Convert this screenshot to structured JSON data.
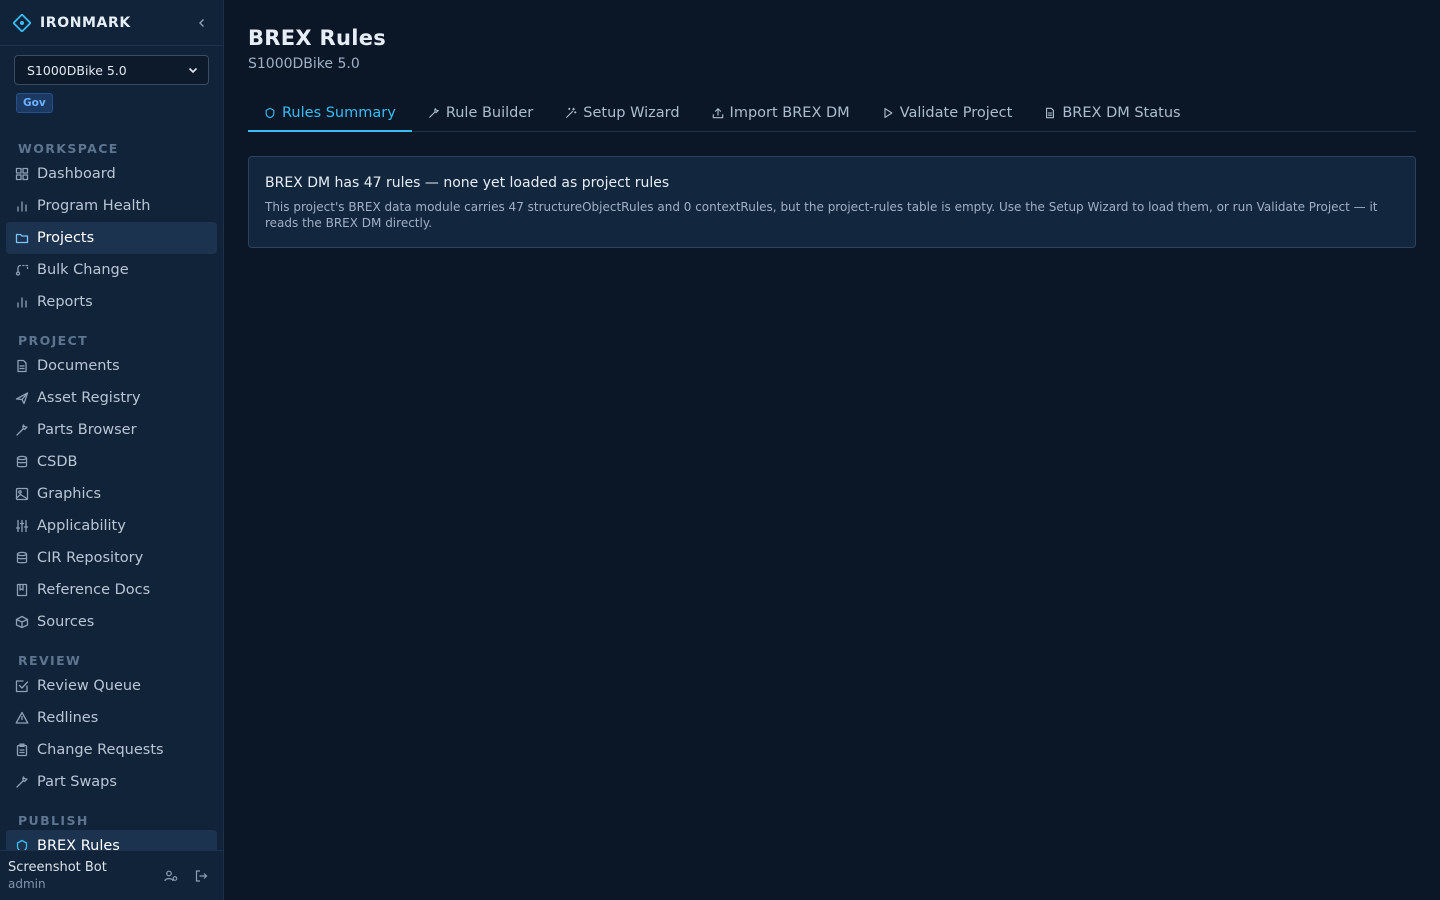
{
  "brand": {
    "name": "IRONMARK"
  },
  "project_select": {
    "value": "S1000DBike 5.0"
  },
  "badge": "Gov",
  "sections": {
    "workspace": "WORKSPACE",
    "project": "PROJECT",
    "review": "REVIEW",
    "publish": "PUBLISH"
  },
  "nav": {
    "workspace": [
      {
        "label": "Dashboard",
        "icon": "grid-icon"
      },
      {
        "label": "Program Health",
        "icon": "bar-chart-icon"
      },
      {
        "label": "Projects",
        "icon": "folder-icon",
        "active": true
      },
      {
        "label": "Bulk Change",
        "icon": "bulk-icon"
      },
      {
        "label": "Reports",
        "icon": "bar-chart-icon"
      }
    ],
    "project": [
      {
        "label": "Documents",
        "icon": "document-icon"
      },
      {
        "label": "Asset Registry",
        "icon": "plane-icon"
      },
      {
        "label": "Parts Browser",
        "icon": "wrench-icon"
      },
      {
        "label": "CSDB",
        "icon": "database-icon"
      },
      {
        "label": "Graphics",
        "icon": "image-icon"
      },
      {
        "label": "Applicability",
        "icon": "sliders-icon"
      },
      {
        "label": "CIR Repository",
        "icon": "database-icon"
      },
      {
        "label": "Reference Docs",
        "icon": "book-icon"
      },
      {
        "label": "Sources",
        "icon": "package-icon"
      }
    ],
    "review": [
      {
        "label": "Review Queue",
        "icon": "check-square-icon"
      },
      {
        "label": "Redlines",
        "icon": "warning-icon"
      },
      {
        "label": "Change Requests",
        "icon": "clipboard-icon"
      },
      {
        "label": "Part Swaps",
        "icon": "wrench-icon"
      }
    ],
    "publish": [
      {
        "label": "BREX Rules",
        "icon": "shield-icon",
        "active": true
      }
    ]
  },
  "user": {
    "name": "Screenshot Bot",
    "role": "admin"
  },
  "page": {
    "title": "BREX Rules",
    "subtitle": "S1000DBike 5.0"
  },
  "tabs": [
    {
      "label": "Rules Summary",
      "icon": "shield-icon",
      "active": true
    },
    {
      "label": "Rule Builder",
      "icon": "wrench-icon"
    },
    {
      "label": "Setup Wizard",
      "icon": "wand-icon"
    },
    {
      "label": "Import BREX DM",
      "icon": "upload-icon"
    },
    {
      "label": "Validate Project",
      "icon": "play-icon"
    },
    {
      "label": "BREX DM Status",
      "icon": "document-icon"
    }
  ],
  "notice": {
    "title": "BREX DM has 47 rules — none yet loaded as project rules",
    "body": "This project's BREX data module carries 47 structureObjectRules and 0 contextRules, but the project-rules table is empty. Use the Setup Wizard to load them, or run Validate Project — it reads the BREX DM directly."
  },
  "colors": {
    "accent": "#38bdf8",
    "background": "#0b1727",
    "sidebar": "#102338"
  }
}
